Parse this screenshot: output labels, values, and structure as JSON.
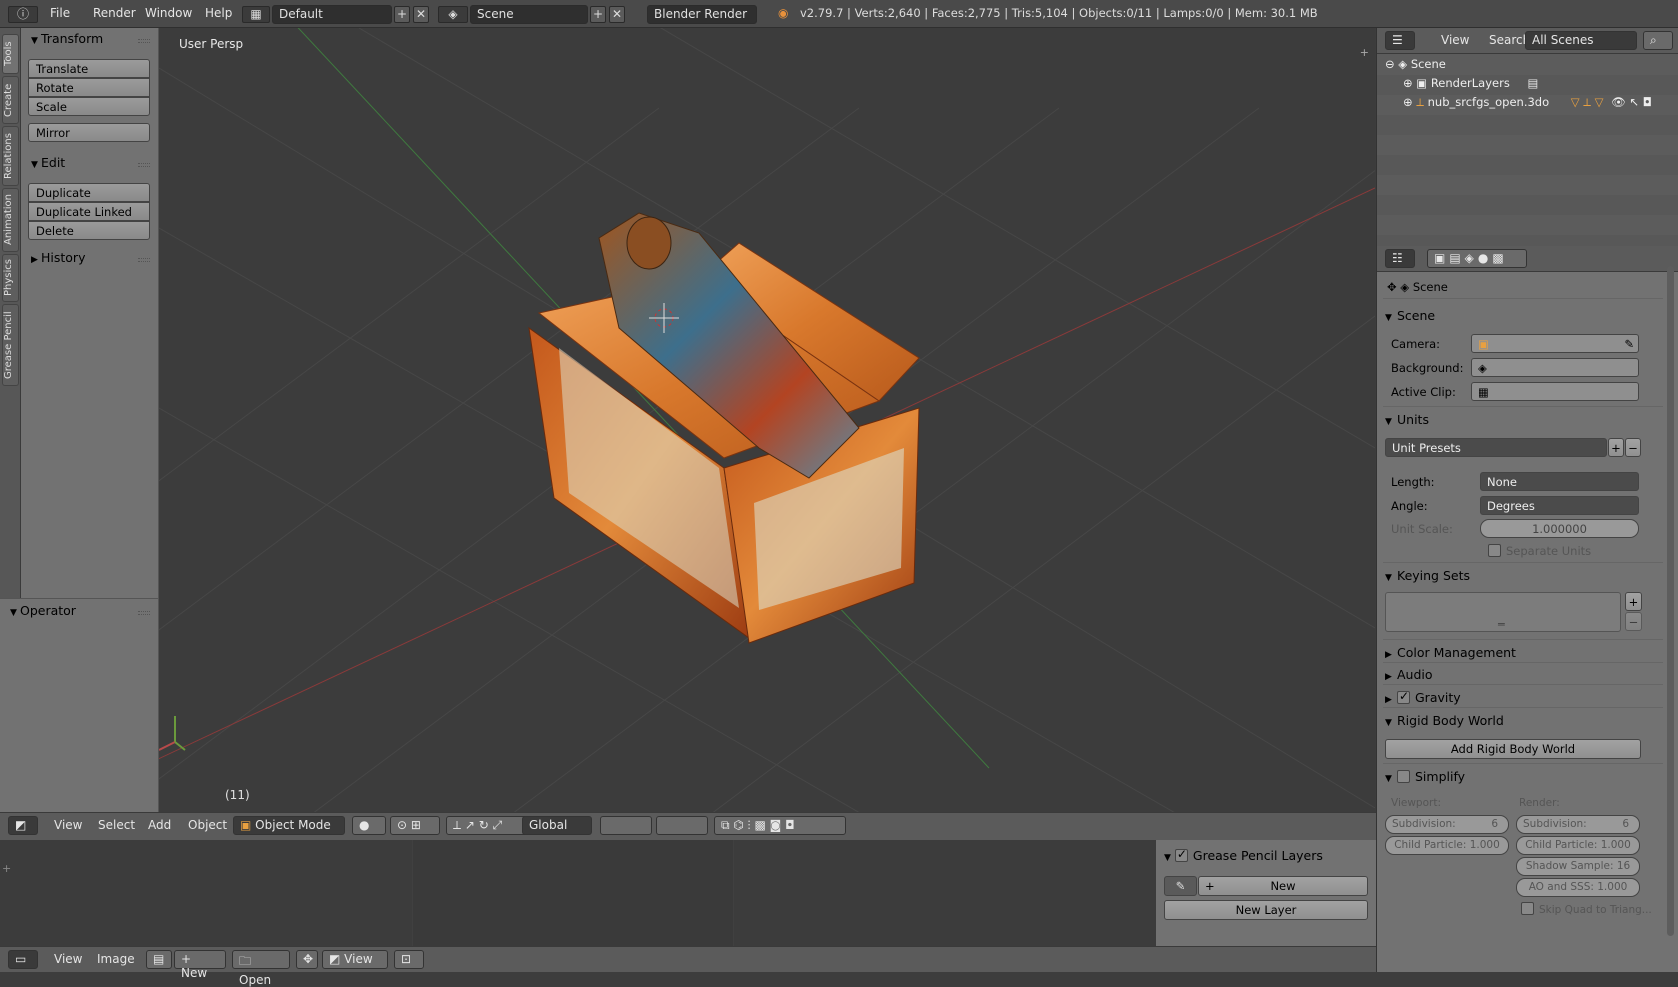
{
  "topbar": {
    "menus": [
      "File",
      "Render",
      "Window",
      "Help"
    ],
    "layout": "Default",
    "scene": "Scene",
    "engine": "Blender Render",
    "stats": "v2.79.7 | Verts:2,640 | Faces:2,775 | Tris:5,104 | Objects:0/11 | Lamps:0/0 | Mem: 30.1 MB"
  },
  "tabs": [
    "Tools",
    "Create",
    "Relations",
    "Animation",
    "Physics",
    "Grease Pencil"
  ],
  "toolshelf": {
    "transform_title": "Transform",
    "translate": "Translate",
    "rotate": "Rotate",
    "scale": "Scale",
    "mirror": "Mirror",
    "edit_title": "Edit",
    "duplicate": "Duplicate",
    "duplicate_linked": "Duplicate Linked",
    "delete": "Delete",
    "history_title": "History",
    "operator_title": "Operator"
  },
  "viewport": {
    "view_label": "User Persp",
    "frame": "(11)"
  },
  "view3d_header": {
    "menus": [
      "View",
      "Select",
      "Add",
      "Object"
    ],
    "mode": "Object Mode",
    "orientation": "Global"
  },
  "image_header": {
    "menus": [
      "View",
      "Image"
    ],
    "new": "New",
    "open": "Open",
    "view": "View"
  },
  "grease_pencil": {
    "title": "Grease Pencil Layers",
    "new": "New",
    "new_layer": "New Layer"
  },
  "outliner": {
    "view": "View",
    "search": "Search",
    "filter": "All Scenes",
    "tree": [
      "Scene",
      "RenderLayers",
      "nub_srcfgs_open.3do"
    ]
  },
  "properties": {
    "breadcrumb": "Scene",
    "scene_title": "Scene",
    "camera_label": "Camera:",
    "background_label": "Background:",
    "active_clip_label": "Active Clip:",
    "units_title": "Units",
    "unit_presets": "Unit Presets",
    "length_label": "Length:",
    "length_value": "None",
    "angle_label": "Angle:",
    "angle_value": "Degrees",
    "unit_scale_label": "Unit Scale:",
    "unit_scale_value": "1.000000",
    "separate_units": "Separate Units",
    "keying_sets_title": "Keying Sets",
    "color_management": "Color Management",
    "audio": "Audio",
    "gravity": "Gravity",
    "rigid_body_world": "Rigid Body World",
    "add_rigid_body_world": "Add Rigid Body World",
    "simplify": "Simplify",
    "viewport_label": "Viewport:",
    "render_label": "Render:",
    "subdivision_vp": "Subdivision:",
    "subdivision_vp_value": "6",
    "subdivision_r": "Subdivision:",
    "subdivision_r_value": "6",
    "child_particle_vp": "Child Particle: 1.000",
    "child_particle_r": "Child Particle: 1.000",
    "shadow_sample": "Shadow Sample: 16",
    "ao_sss": "AO and SSS:  1.000",
    "skip_quad": "Skip Quad to Triang..."
  }
}
